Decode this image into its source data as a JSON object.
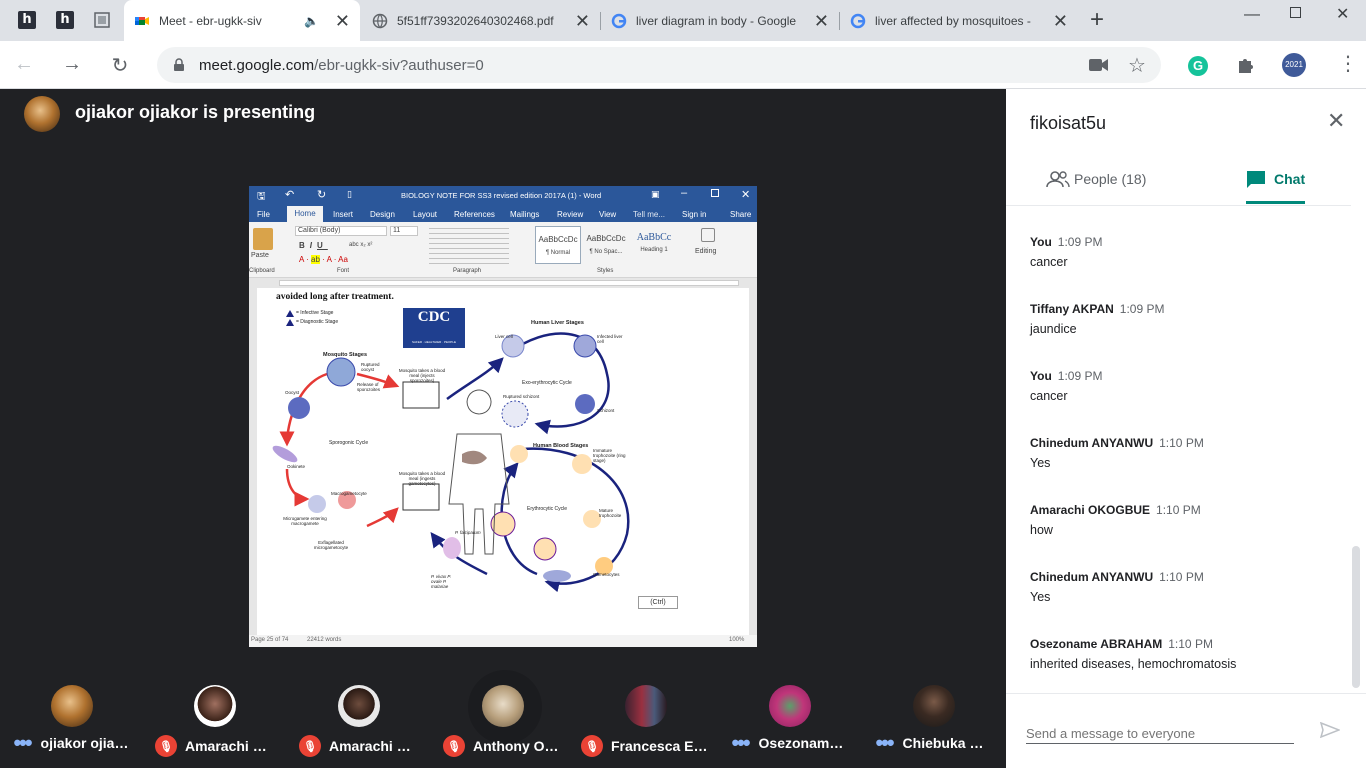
{
  "browser": {
    "pinned_tabs": [
      "h",
      "h",
      ""
    ],
    "tabs": [
      {
        "title": "Meet - ebr-ugkk-siv",
        "icon": "meet-icon",
        "active": true
      },
      {
        "title": "5f51ff7393202640302468.pdf",
        "icon": "globe-icon"
      },
      {
        "title": "liver diagram in body - Google",
        "icon": "google-icon"
      },
      {
        "title": "liver affected by mosquitoes -",
        "icon": "google-icon"
      }
    ],
    "url_host": "meet.google.com",
    "url_path": "/ebr-ugkk-siv?authuser=0",
    "profile_label": "2021"
  },
  "meeting": {
    "presenting_text": "ojiakor ojiakor is presenting"
  },
  "word": {
    "title": "BIOLOGY NOTE FOR SS3 revised edition 2017A (1) - Word",
    "tabs": [
      "File",
      "Home",
      "Insert",
      "Design",
      "Layout",
      "References",
      "Mailings",
      "Review",
      "View",
      "Tell me...",
      "Sign in",
      "Share"
    ],
    "font_name": "Calibri (Body)",
    "font_size": "11",
    "paste_label": "Paste",
    "clipboard_label": "Clipboard",
    "font_group_label": "Font",
    "paragraph_label": "Paragraph",
    "styles_label": "Styles",
    "editing_label": "Editing",
    "styles": [
      {
        "sample": "AaBbCcDc",
        "name": "¶ Normal"
      },
      {
        "sample": "AaBbCcDc",
        "name": "¶ No Spac..."
      },
      {
        "sample": "AaBbCc",
        "name": "Heading 1"
      }
    ],
    "doc_text": "avoided long after treatment.",
    "diagram": {
      "logo": "CDC",
      "logo_sub": "SAFER · HEALTHIER · PEOPLE",
      "legend": [
        "= Infective Stage",
        "= Diagnostic Stage"
      ],
      "mosquito_stages": "Mosquito Stages",
      "human_liver_stages": "Human Liver Stages",
      "human_blood_stages": "Human Blood Stages",
      "sporogonic_cycle": "Sporogonic Cycle",
      "exo_cycle": "Exo-erythrocytic Cycle",
      "erythrocytic_cycle": "Erythrocytic Cycle",
      "labels": [
        "Ruptured oocyst",
        "Release of sporozoites",
        "Oocyst",
        "Ookinete",
        "Macrogametocyte",
        "Microgamete entering macrogamete",
        "Exflagellated microgametocyte",
        "Mosquito takes a blood meal (injects sporozoites)",
        "Mosquito takes a blood meal (ingests gametocytes)",
        "Liver cell",
        "Infected liver cell",
        "Ruptured schizont",
        "Schizont",
        "Immature trophozoite (ring stage)",
        "Mature trophozoite",
        "Gametocytes",
        "P. falciparum",
        "P. vivax P. ovale P. malariae"
      ],
      "paste_tag": "(Ctrl)"
    },
    "status": {
      "page": "Page 25 of 74",
      "words": "22412 words",
      "zoom": "100%"
    }
  },
  "participants": [
    {
      "name": "ojiakor ojiakor",
      "status": "dots",
      "avatar": "#b0722f"
    },
    {
      "name": "Amarachi OP...",
      "status": "muted",
      "avatar": "#2a1a16"
    },
    {
      "name": "Amarachi OK...",
      "status": "muted",
      "avatar": "#3a2a24"
    },
    {
      "name": "Anthony OK...",
      "status": "muted",
      "avatar": "#c9b89a"
    },
    {
      "name": "Francesca ETA",
      "status": "muted",
      "avatar": "#7a2a3a"
    },
    {
      "name": "Osezoname ...",
      "status": "dots",
      "avatar": "#c0367a"
    },
    {
      "name": "Chiebuka ON...",
      "status": "dots",
      "avatar": "#4a3a30"
    }
  ],
  "panel": {
    "title": "fikoisat5u",
    "people_tab": "People (18)",
    "chat_tab": "Chat",
    "input_placeholder": "Send a message to everyone",
    "messages": [
      {
        "sender": "You",
        "time": "1:09 PM",
        "text": "cancer"
      },
      {
        "sender": "Tiffany AKPAN",
        "time": "1:09 PM",
        "text": "jaundice"
      },
      {
        "sender": "You",
        "time": "1:09 PM",
        "text": "cancer"
      },
      {
        "sender": "Chinedum ANYANWU",
        "time": "1:10 PM",
        "text": "Yes"
      },
      {
        "sender": "Amarachi OKOGBUE",
        "time": "1:10 PM",
        "text": "how"
      },
      {
        "sender": "Chinedum ANYANWU",
        "time": "1:10 PM",
        "text": "Yes"
      },
      {
        "sender": "Osezoname ABRAHAM",
        "time": "1:10 PM",
        "text": "inherited diseases, hemochromatosis"
      }
    ]
  },
  "colors": {
    "accent": "#00897b",
    "meet_dark": "#202124",
    "word_blue": "#2b579a",
    "cycle_blue": "#1a237e",
    "cycle_red": "#e53935"
  }
}
